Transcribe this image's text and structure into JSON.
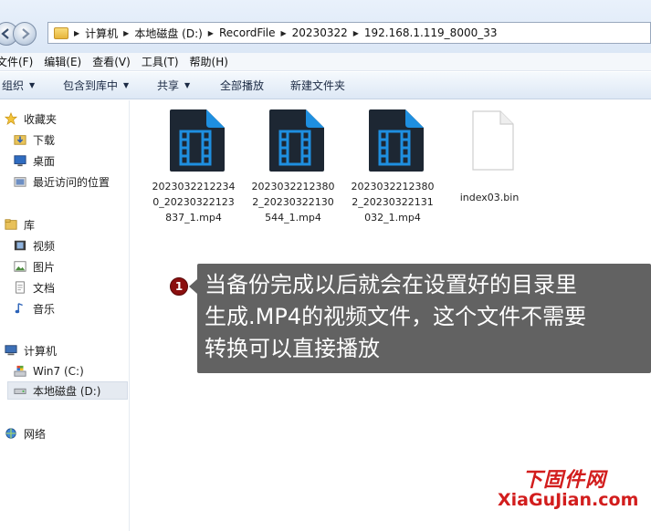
{
  "address": {
    "crumbs": [
      "计算机",
      "本地磁盘 (D:)",
      "RecordFile",
      "20230322",
      "192.168.1.119_8000_33"
    ]
  },
  "menu": {
    "items": [
      "文件(F)",
      "编辑(E)",
      "查看(V)",
      "工具(T)",
      "帮助(H)"
    ]
  },
  "toolbar": {
    "organize": "组织",
    "include_library": "包含到库中",
    "share": "共享",
    "play_all": "全部播放",
    "new_folder": "新建文件夹"
  },
  "navpane": {
    "favorites": "收藏夹",
    "downloads": "下载",
    "desktop": "桌面",
    "recent": "最近访问的位置",
    "libraries": "库",
    "videos": "视频",
    "pictures": "图片",
    "documents": "文档",
    "music": "音乐",
    "computer": "计算机",
    "win7": "Win7 (C:)",
    "local_disk": "本地磁盘 (D:)",
    "network": "网络"
  },
  "files": [
    {
      "name": "20230322122340_20230322123837_1.mp4",
      "line1": "2023032212234",
      "line2": "0_20230322123",
      "line3": "837_1.mp4",
      "type": "video"
    },
    {
      "name": "20230322123802_20230322130544_1.mp4",
      "line1": "2023032212380",
      "line2": "2_20230322130",
      "line3": "544_1.mp4",
      "type": "video"
    },
    {
      "name": "20230322123802_20230322131032_1.mp4",
      "line1": "2023032212380",
      "line2": "2_20230322131",
      "line3": "032_1.mp4",
      "type": "video"
    },
    {
      "name": "index03.bin",
      "line1": "index03.bin",
      "line2": "",
      "line3": "",
      "type": "bin"
    }
  ],
  "annotation": {
    "number": "1",
    "line1": "当备份完成以后就会在设置好的目录里",
    "line2": "生成.MP4的视频文件，这个文件不需要",
    "line3": "转换可以直接播放"
  },
  "watermark": {
    "top": "下固件网",
    "bottom": "XiaGuJian.com"
  },
  "colors": {
    "annotation_bg": "#565656",
    "badge": "#8b0f0f",
    "watermark": "#d21d1d",
    "video_icon_bg": "#1d2733",
    "video_icon_accent": "#1e8fe0"
  }
}
